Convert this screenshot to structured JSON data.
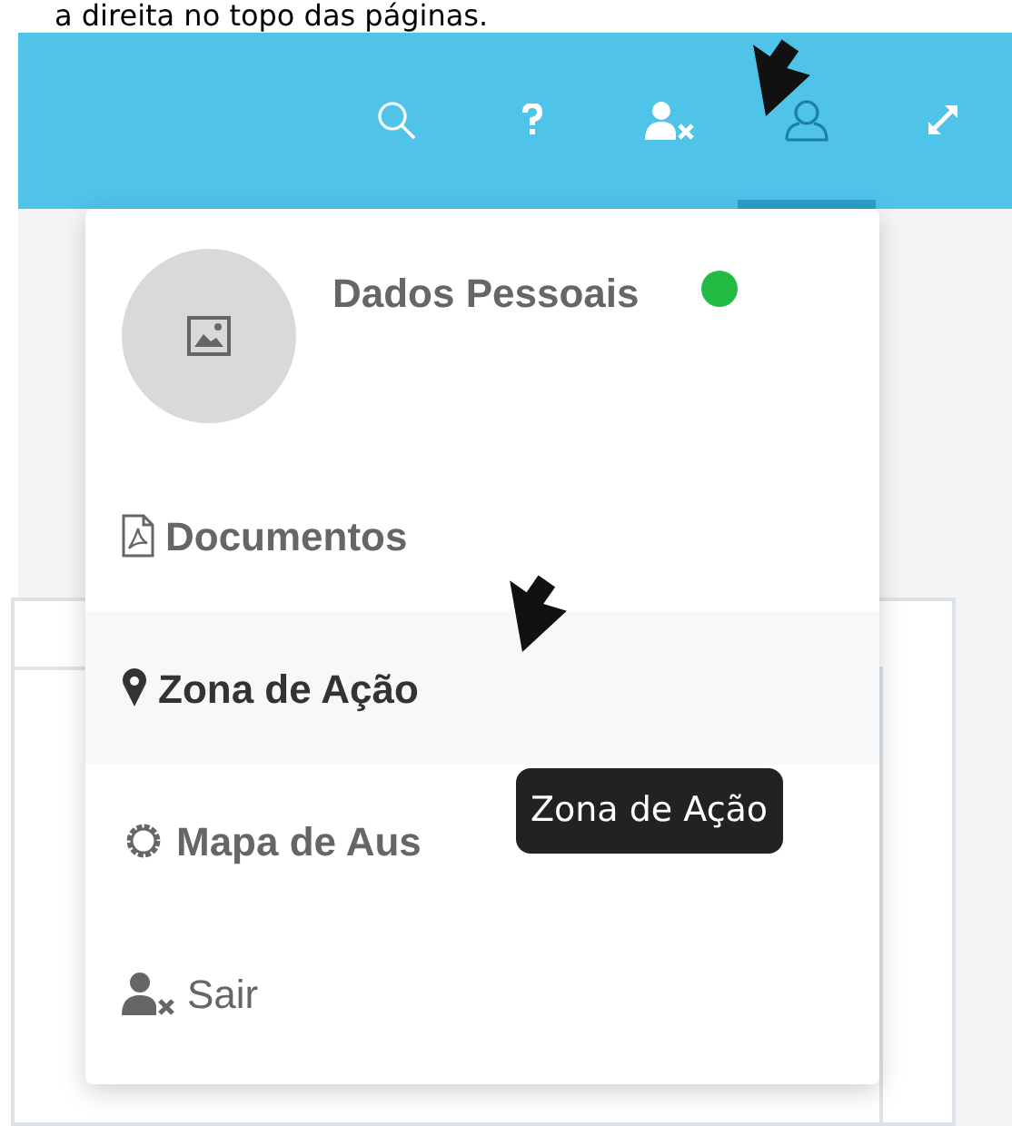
{
  "caption": "a direita no topo das páginas.",
  "toolbar": [
    {
      "kind": "search",
      "selected": false
    },
    {
      "kind": "help",
      "selected": false
    },
    {
      "kind": "user-remove",
      "selected": false
    },
    {
      "kind": "user",
      "selected": true
    },
    {
      "kind": "expand",
      "selected": false
    }
  ],
  "profile_menu": {
    "title": "Dados Pessoais",
    "status_dot": {
      "color": "#22bb44"
    },
    "items": [
      {
        "kind": "document",
        "label": "Documentos",
        "selected": false
      },
      {
        "kind": "location",
        "label": "Zona de Ação",
        "selected": true
      },
      {
        "kind": "settings",
        "label": "Mapa de Aus",
        "selected": false
      },
      {
        "kind": "logout",
        "label": "Sair",
        "selected": false
      }
    ]
  },
  "tooltip": "Zona de Ação"
}
